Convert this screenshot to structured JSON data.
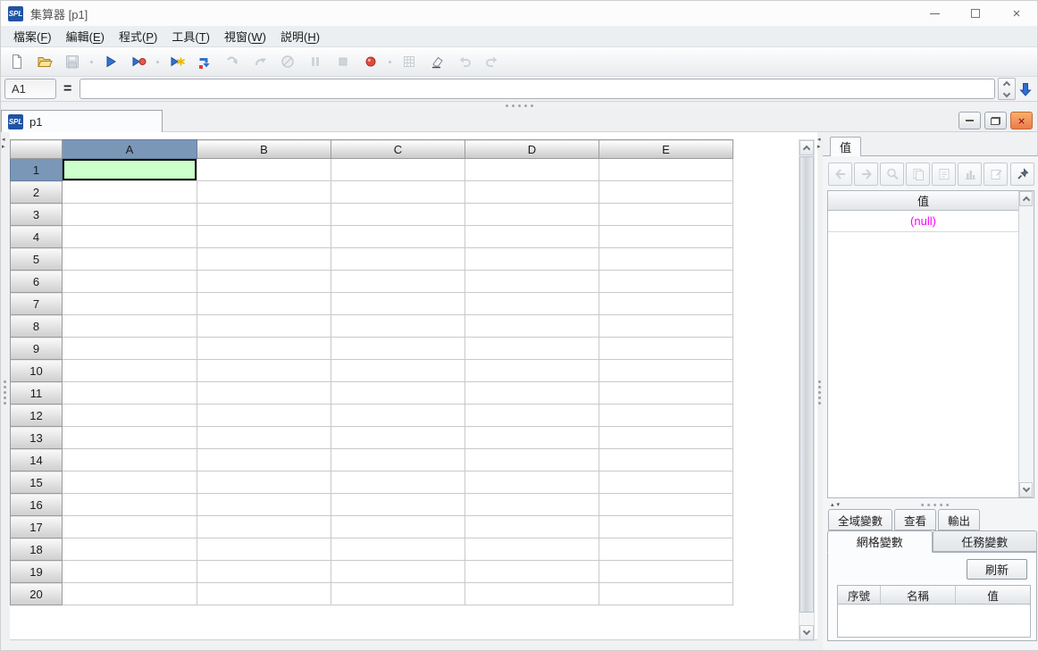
{
  "window": {
    "logo_text": "SPL",
    "title": "集算器 [p1]",
    "close_glyph": "×"
  },
  "menu": {
    "items": [
      {
        "label": "檔案",
        "mnemonic": "F"
      },
      {
        "label": "編輯",
        "mnemonic": "E"
      },
      {
        "label": "程式",
        "mnemonic": "P"
      },
      {
        "label": "工具",
        "mnemonic": "T"
      },
      {
        "label": "視窗",
        "mnemonic": "W"
      },
      {
        "label": "説明",
        "mnemonic": "H"
      }
    ]
  },
  "toolbar": {
    "buttons": [
      {
        "icon": "new-file-icon",
        "enabled": true
      },
      {
        "icon": "open-file-icon",
        "enabled": true
      },
      {
        "icon": "save-icon",
        "enabled": false
      },
      {
        "icon": "run-icon",
        "enabled": true
      },
      {
        "icon": "debug-run-icon",
        "enabled": true
      },
      {
        "icon": "step-run-icon",
        "enabled": true
      },
      {
        "icon": "run-to-cursor-icon",
        "enabled": true
      },
      {
        "icon": "step-over-icon",
        "enabled": false
      },
      {
        "icon": "step-return-icon",
        "enabled": false
      },
      {
        "icon": "cancel-icon",
        "enabled": false
      },
      {
        "icon": "pause-icon",
        "enabled": false
      },
      {
        "icon": "stop-icon",
        "enabled": false
      },
      {
        "icon": "breakpoint-icon",
        "enabled": true
      },
      {
        "icon": "calc-cell-icon",
        "enabled": false
      },
      {
        "icon": "clear-icon",
        "enabled": true
      },
      {
        "icon": "undo-icon",
        "enabled": false
      },
      {
        "icon": "redo-icon",
        "enabled": false
      }
    ]
  },
  "formula_bar": {
    "cell_ref": "A1",
    "equals_label": "=",
    "value": ""
  },
  "sheet_tab": {
    "label": "p1"
  },
  "grid": {
    "columns": [
      "A",
      "B",
      "C",
      "D",
      "E"
    ],
    "rows": [
      "1",
      "2",
      "3",
      "4",
      "5",
      "6",
      "7",
      "8",
      "9",
      "10",
      "11",
      "12",
      "13",
      "14",
      "15",
      "16",
      "17",
      "18",
      "19",
      "20"
    ],
    "selected_cell": {
      "column": "A",
      "row": "1"
    },
    "selection_color": "#ccffcc",
    "header_selected_color": "#7a97b8"
  },
  "right_panel": {
    "tab_label": "值",
    "toolbar": [
      {
        "icon": "back-icon",
        "enabled": false
      },
      {
        "icon": "forward-icon",
        "enabled": false
      },
      {
        "icon": "zoom-icon",
        "enabled": false
      },
      {
        "icon": "copy-icon",
        "enabled": false
      },
      {
        "icon": "cell-text-icon",
        "enabled": false
      },
      {
        "icon": "chart-icon",
        "enabled": false
      },
      {
        "icon": "properties-icon",
        "enabled": false
      },
      {
        "icon": "pin-icon",
        "enabled": true
      }
    ],
    "value_table": {
      "header": "值",
      "rows": [
        "(null)"
      ],
      "null_color": "#ff00ff"
    },
    "small_tabs": [
      "全域變數",
      "查看",
      "輸出"
    ],
    "variable_tabs": [
      {
        "label": "網格變數",
        "selected": true
      },
      {
        "label": "任務變數",
        "selected": false
      }
    ],
    "refresh_label": "刷新",
    "variable_table": {
      "headers": [
        "序號",
        "名稱",
        "值"
      ],
      "rows": []
    }
  }
}
